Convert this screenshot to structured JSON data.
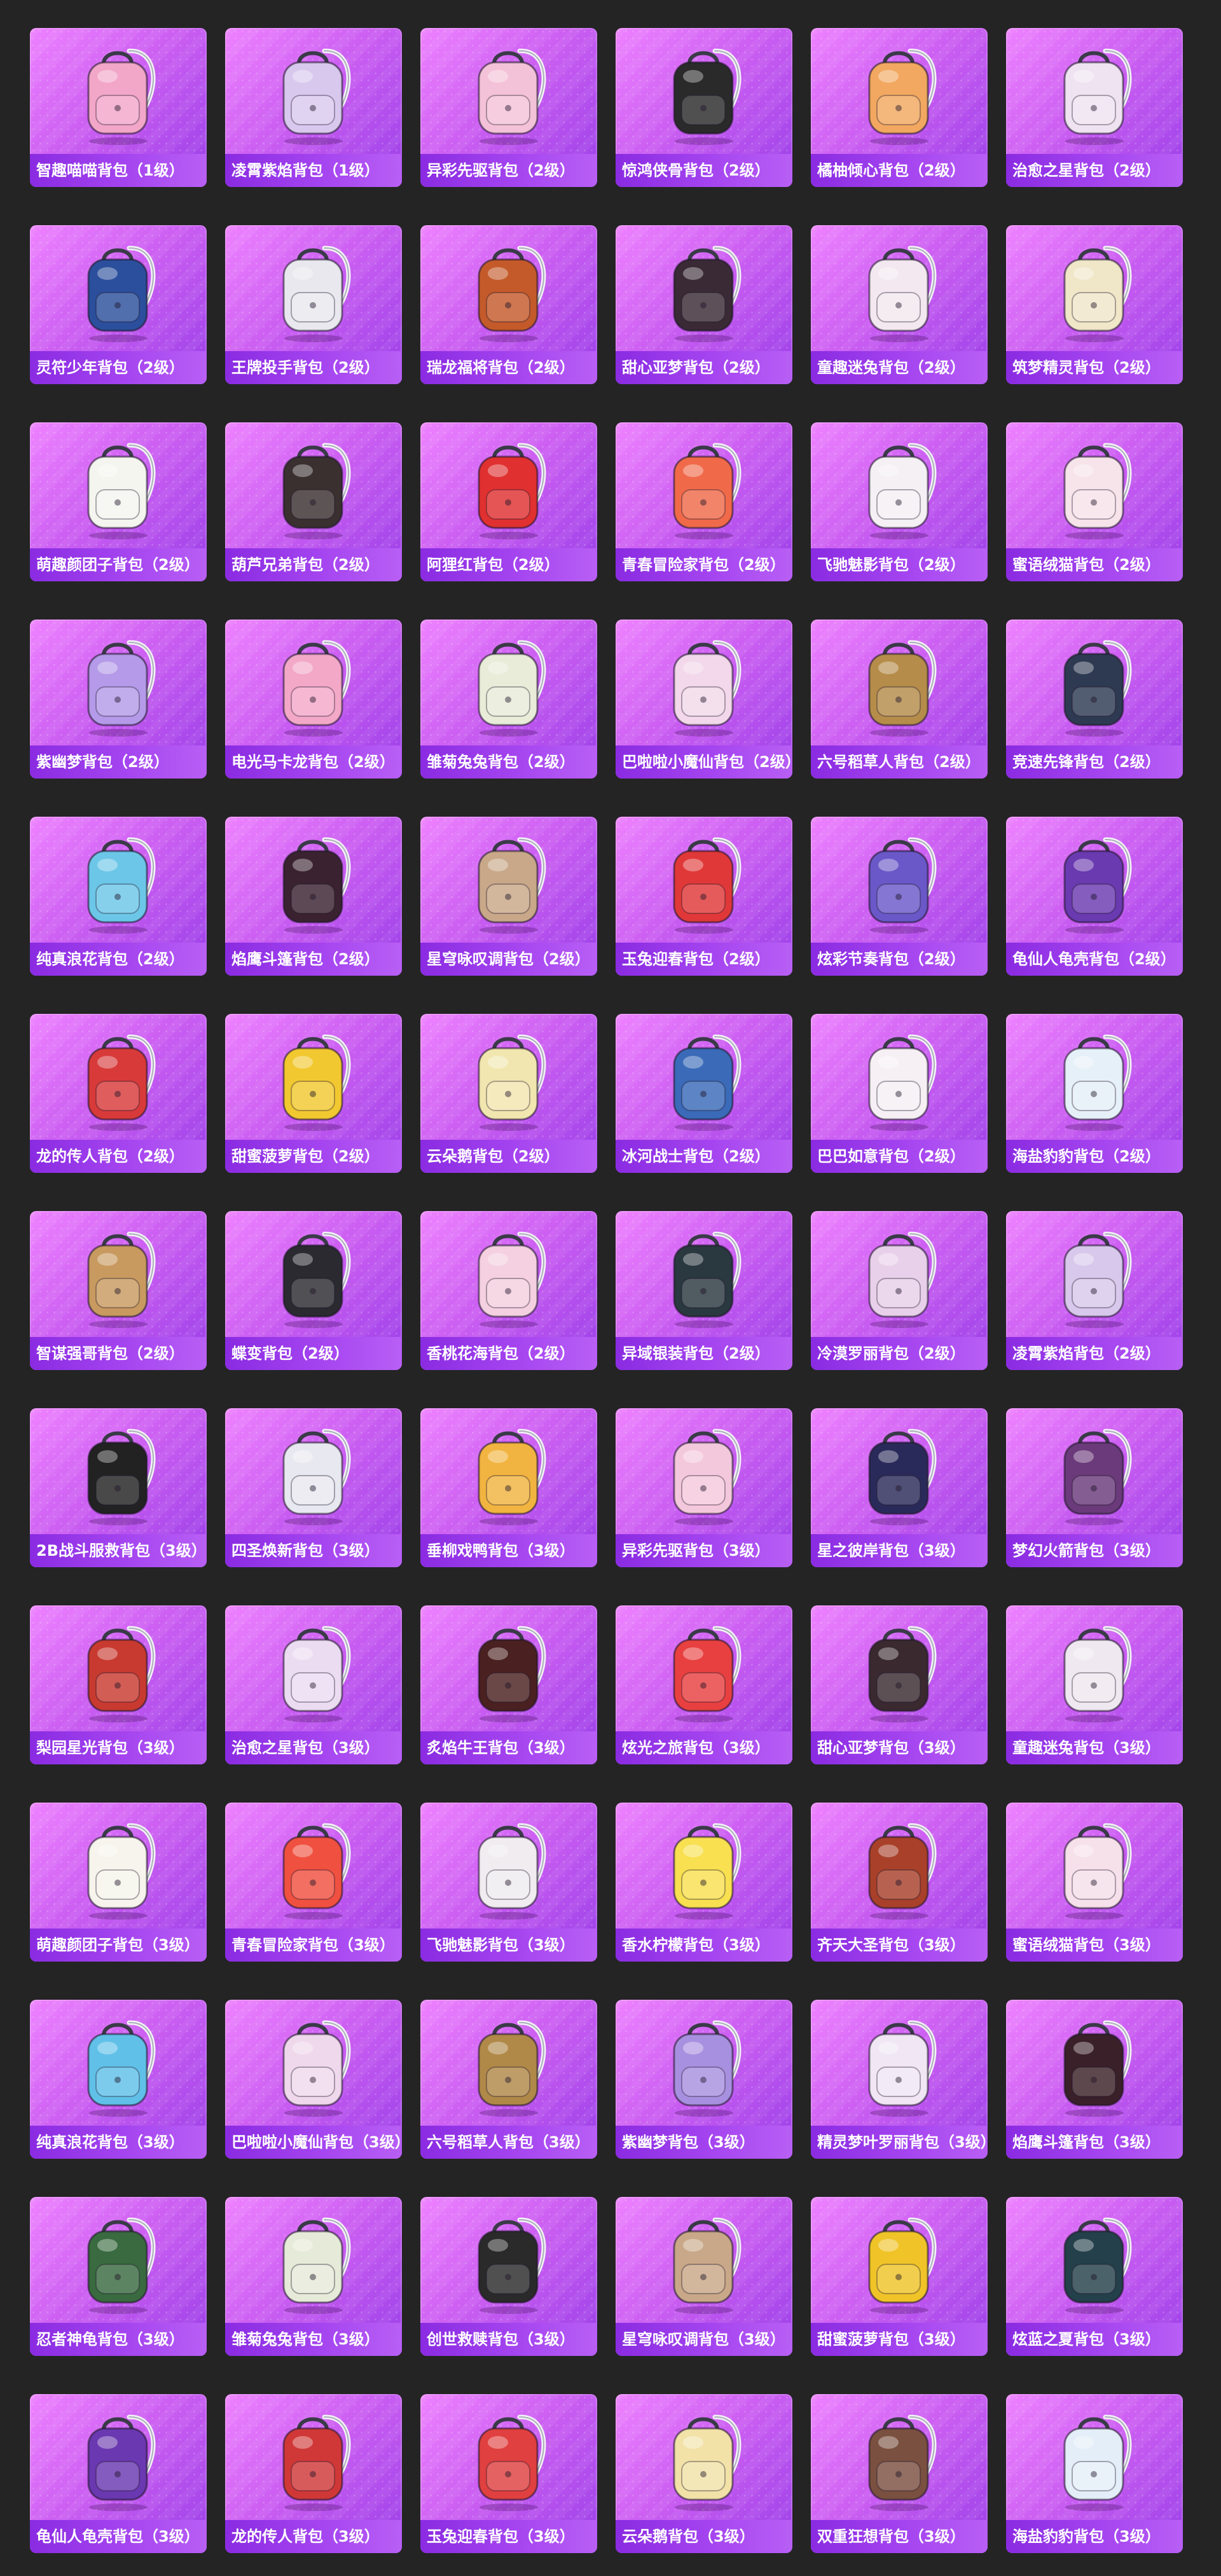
{
  "colors": {
    "page_background": "#242424",
    "card_gradient": [
      "#ee82ff",
      "#cc5ff2",
      "#9a3fe8"
    ],
    "label_background": "#8a2be2",
    "label_text": "#ffffff"
  },
  "items": [
    {
      "label": "智趣喵喵背包（1级）",
      "icon": "backpack-icon",
      "color": "#f2a6c8"
    },
    {
      "label": "凌霄紫焰背包（1级）",
      "icon": "backpack-icon",
      "color": "#d9c8ee"
    },
    {
      "label": "异彩先驱背包（2级）",
      "icon": "backpack-icon",
      "color": "#f4c2d8"
    },
    {
      "label": "惊鸿侠骨背包（2级）",
      "icon": "backpack-icon",
      "color": "#2a2a2a"
    },
    {
      "label": "橘柚倾心背包（2级）",
      "icon": "backpack-icon",
      "color": "#f2a860"
    },
    {
      "label": "治愈之星背包（2级）",
      "icon": "backpack-icon",
      "color": "#efe3f2"
    },
    {
      "label": "灵符少年背包（2级）",
      "icon": "backpack-icon",
      "color": "#2b4f9c"
    },
    {
      "label": "王牌投手背包（2级）",
      "icon": "backpack-icon",
      "color": "#e8e8ee"
    },
    {
      "label": "瑞龙福将背包（2级）",
      "icon": "backpack-icon",
      "color": "#c45a2a"
    },
    {
      "label": "甜心亚梦背包（2级）",
      "icon": "backpack-icon",
      "color": "#3a2a35"
    },
    {
      "label": "童趣迷兔背包（2级）",
      "icon": "backpack-icon",
      "color": "#f3e8f0"
    },
    {
      "label": "筑梦精灵背包（2级）",
      "icon": "backpack-icon",
      "color": "#f0e6c8"
    },
    {
      "label": "萌趣颜团子背包（2级）",
      "icon": "backpack-icon",
      "color": "#f5f5f0"
    },
    {
      "label": "葫芦兄弟背包（2级）",
      "icon": "backpack-icon",
      "color": "#3a3030"
    },
    {
      "label": "阿狸红背包（2级）",
      "icon": "backpack-icon",
      "color": "#e03030"
    },
    {
      "label": "青春冒险家背包（2级）",
      "icon": "backpack-icon",
      "color": "#f06a4a"
    },
    {
      "label": "飞驰魅影背包（2级）",
      "icon": "backpack-icon",
      "color": "#f4f0f4"
    },
    {
      "label": "蜜语绒猫背包（2级）",
      "icon": "backpack-icon",
      "color": "#f7e3ea"
    },
    {
      "label": "紫幽梦背包（2级）",
      "icon": "backpack-icon",
      "color": "#b49ae8"
    },
    {
      "label": "电光马卡龙背包（2级）",
      "icon": "backpack-icon",
      "color": "#f3a8c8"
    },
    {
      "label": "雏菊兔兔背包（2级）",
      "icon": "backpack-icon",
      "color": "#e8ecd8"
    },
    {
      "label": "巴啦啦小魔仙背包（2级）",
      "icon": "backpack-icon",
      "color": "#f2d8ea"
    },
    {
      "label": "六号稻草人背包（2级）",
      "icon": "backpack-icon",
      "color": "#b58c4a"
    },
    {
      "label": "竞速先锋背包（2级）",
      "icon": "backpack-icon",
      "color": "#2e3a52"
    },
    {
      "label": "纯真浪花背包（2级）",
      "icon": "backpack-icon",
      "color": "#6cc6e8"
    },
    {
      "label": "焰鹰斗篷背包（2级）",
      "icon": "backpack-icon",
      "color": "#3a2230"
    },
    {
      "label": "星穹咏叹调背包（2级）",
      "icon": "backpack-icon",
      "color": "#c8a888"
    },
    {
      "label": "玉兔迎春背包（2级）",
      "icon": "backpack-icon",
      "color": "#e03838"
    },
    {
      "label": "炫彩节奏背包（2级）",
      "icon": "backpack-icon",
      "color": "#6a58c8"
    },
    {
      "label": "龟仙人龟壳背包（2级）",
      "icon": "backpack-icon",
      "color": "#6a3ab0"
    },
    {
      "label": "龙的传人背包（2级）",
      "icon": "backpack-icon",
      "color": "#d83a3a"
    },
    {
      "label": "甜蜜菠萝背包（2级）",
      "icon": "backpack-icon",
      "color": "#f2c830"
    },
    {
      "label": "云朵鹅背包（2级）",
      "icon": "backpack-icon",
      "color": "#f2e6b0"
    },
    {
      "label": "冰河战士背包（2级）",
      "icon": "backpack-icon",
      "color": "#3a6ab8"
    },
    {
      "label": "巴巴如意背包（2级）",
      "icon": "backpack-icon",
      "color": "#f6f0f4"
    },
    {
      "label": "海盐豹豹背包（2级）",
      "icon": "backpack-icon",
      "color": "#e6f0f8"
    },
    {
      "label": "智谋强哥背包（2级）",
      "icon": "backpack-icon",
      "color": "#c89a60"
    },
    {
      "label": "蝶变背包（2级）",
      "icon": "backpack-icon",
      "color": "#2a2a30"
    },
    {
      "label": "香桃花海背包（2级）",
      "icon": "backpack-icon",
      "color": "#f4d0e0"
    },
    {
      "label": "异域银装背包（2级）",
      "icon": "backpack-icon",
      "color": "#2a3840"
    },
    {
      "label": "冷漠罗丽背包（2级）",
      "icon": "backpack-icon",
      "color": "#e8d0ea"
    },
    {
      "label": "凌霄紫焰背包（2级）",
      "icon": "backpack-icon",
      "color": "#d8c8ec"
    },
    {
      "label": "2B战斗服救背包（3级）",
      "icon": "backpack-icon",
      "color": "#222222"
    },
    {
      "label": "四圣焕新背包（3级）",
      "icon": "backpack-icon",
      "color": "#e8e8f0"
    },
    {
      "label": "垂柳戏鸭背包（3级）",
      "icon": "backpack-icon",
      "color": "#f2b440"
    },
    {
      "label": "异彩先驱背包（3级）",
      "icon": "backpack-icon",
      "color": "#f4c8dc"
    },
    {
      "label": "星之彼岸背包（3级）",
      "icon": "backpack-icon",
      "color": "#2a2a5a"
    },
    {
      "label": "梦幻火箭背包（3级）",
      "icon": "backpack-icon",
      "color": "#6a3a7a"
    },
    {
      "label": "梨园星光背包（3级）",
      "icon": "backpack-icon",
      "color": "#c83a30"
    },
    {
      "label": "治愈之星背包（3级）",
      "icon": "backpack-icon",
      "color": "#ecdcf2"
    },
    {
      "label": "炙焰牛王背包（3级）",
      "icon": "backpack-icon",
      "color": "#4a2020"
    },
    {
      "label": "炫光之旅背包（3级）",
      "icon": "backpack-icon",
      "color": "#e84040"
    },
    {
      "label": "甜心亚梦背包（3级）",
      "icon": "backpack-icon",
      "color": "#3a2a30"
    },
    {
      "label": "童趣迷兔背包（3级）",
      "icon": "backpack-icon",
      "color": "#f0e8f0"
    },
    {
      "label": "萌趣颜团子背包（3级）",
      "icon": "backpack-icon",
      "color": "#f6f4ec"
    },
    {
      "label": "青春冒险家背包（3级）",
      "icon": "backpack-icon",
      "color": "#f05040"
    },
    {
      "label": "飞驰魅影背包（3级）",
      "icon": "backpack-icon",
      "color": "#f0ecf0"
    },
    {
      "label": "香水柠檬背包（3级）",
      "icon": "backpack-icon",
      "color": "#f8e050"
    },
    {
      "label": "齐天大圣背包（3级）",
      "icon": "backpack-icon",
      "color": "#a8402a"
    },
    {
      "label": "蜜语绒猫背包（3级）",
      "icon": "backpack-icon",
      "color": "#f6e0ea"
    },
    {
      "label": "纯真浪花背包（3级）",
      "icon": "backpack-icon",
      "color": "#60c0e8"
    },
    {
      "label": "巴啦啦小魔仙背包（3级）",
      "icon": "backpack-icon",
      "color": "#f0d8ec"
    },
    {
      "label": "六号稻草人背包（3级）",
      "icon": "backpack-icon",
      "color": "#b08848"
    },
    {
      "label": "紫幽梦背包（3级）",
      "icon": "backpack-icon",
      "color": "#a890e0"
    },
    {
      "label": "精灵梦叶罗丽背包（3级）",
      "icon": "backpack-icon",
      "color": "#f0e6f4"
    },
    {
      "label": "焰鹰斗篷背包（3级）",
      "icon": "backpack-icon",
      "color": "#3a2028"
    },
    {
      "label": "忍者神龟背包（3级）",
      "icon": "backpack-icon",
      "color": "#3a6a40"
    },
    {
      "label": "雏菊兔兔背包（3级）",
      "icon": "backpack-icon",
      "color": "#e6ead8"
    },
    {
      "label": "创世救赎背包（3级）",
      "icon": "backpack-icon",
      "color": "#2a2a2a"
    },
    {
      "label": "星穹咏叹调背包（3级）",
      "icon": "backpack-icon",
      "color": "#c8a888"
    },
    {
      "label": "甜蜜菠萝背包（3级）",
      "icon": "backpack-icon",
      "color": "#f0c428"
    },
    {
      "label": "炫蓝之夏背包（3级）",
      "icon": "backpack-icon",
      "color": "#24404a"
    },
    {
      "label": "龟仙人龟壳背包（3级）",
      "icon": "backpack-icon",
      "color": "#6a38b0"
    },
    {
      "label": "龙的传人背包（3级）",
      "icon": "backpack-icon",
      "color": "#d03838"
    },
    {
      "label": "玉兔迎春背包（3级）",
      "icon": "backpack-icon",
      "color": "#e04040"
    },
    {
      "label": "云朵鹅背包（3级）",
      "icon": "backpack-icon",
      "color": "#f2e2a8"
    },
    {
      "label": "双重狂想背包（3级）",
      "icon": "backpack-icon",
      "color": "#7a5040"
    },
    {
      "label": "海盐豹豹背包（3级）",
      "icon": "backpack-icon",
      "color": "#e4eef8"
    }
  ]
}
